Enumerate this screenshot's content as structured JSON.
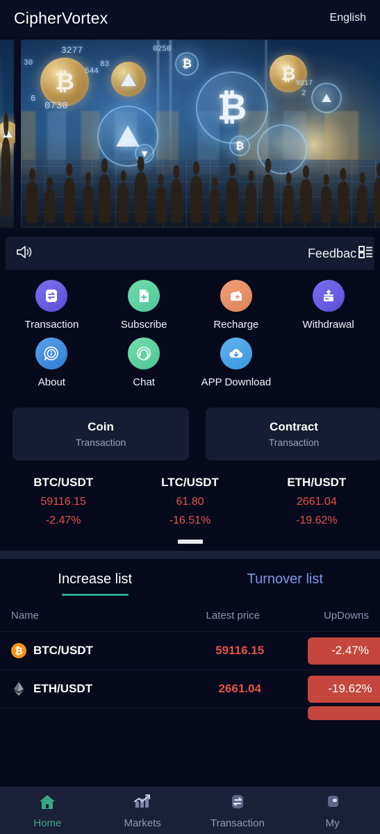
{
  "header": {
    "logo": "CipherVortex",
    "language": "English"
  },
  "banner": {
    "alt": "crypto-trading-banner",
    "slide_numbers": [
      "3277",
      "544",
      "0730",
      "30",
      "6",
      "0250",
      "83",
      "2",
      "9217"
    ]
  },
  "notice": {
    "speaker_icon": "speaker-icon",
    "feedback_label": "Feedbac",
    "grid_icon": "grid-list-icon"
  },
  "quick_menu": {
    "rows": [
      [
        {
          "label": "Transaction",
          "icon": "exchange-icon",
          "color": "#6c5ce7"
        },
        {
          "label": "Subscribe",
          "icon": "document-plus-icon",
          "color": "#63d4a5"
        },
        {
          "label": "Recharge",
          "icon": "wallet-in-icon",
          "color": "#e8936a"
        },
        {
          "label": "Withdrawal",
          "icon": "card-up-icon",
          "color": "#6c5ce7"
        }
      ],
      [
        {
          "label": "About",
          "icon": "info-bubble-icon",
          "color": "#3d8de0"
        },
        {
          "label": "Chat",
          "icon": "headset-icon",
          "color": "#63d4a5"
        },
        {
          "label": "APP Download",
          "icon": "cloud-download-icon",
          "color": "#49a5e8"
        }
      ]
    ]
  },
  "trade_cards": [
    {
      "title": "Coin",
      "subtitle": "Transaction"
    },
    {
      "title": "Contract",
      "subtitle": "Transaction"
    }
  ],
  "ticker": {
    "items": [
      {
        "pair": "BTC/USDT",
        "price": "59116.15",
        "change": "-2.47%"
      },
      {
        "pair": "LTC/USDT",
        "price": "61.80",
        "change": "-16.51%"
      },
      {
        "pair": "ETH/USDT",
        "price": "2661.04",
        "change": "-19.62%"
      }
    ],
    "down_color": "#e3524a"
  },
  "market_list": {
    "tabs": [
      {
        "label": "Increase list",
        "active": true
      },
      {
        "label": "Turnover list",
        "active": false
      }
    ],
    "columns": {
      "name": "Name",
      "price": "Latest price",
      "change": "UpDowns"
    },
    "rows": [
      {
        "pair": "BTC/USDT",
        "price": "59116.15",
        "change": "-2.47%",
        "icon": "bitcoin-icon",
        "symbol": "₿",
        "icon_color": "#f7931a"
      },
      {
        "pair": "ETH/USDT",
        "price": "2661.04",
        "change": "-19.62%",
        "icon": "ethereum-icon",
        "symbol": "",
        "icon_color": "#8b8f99"
      }
    ],
    "badge_color": "#c4463c",
    "accent_color": "#2fa68a"
  },
  "tabbar": [
    {
      "label": "Home",
      "icon": "home-icon",
      "active": true
    },
    {
      "label": "Markets",
      "icon": "chart-icon",
      "active": false
    },
    {
      "label": "Transaction",
      "icon": "exchange-icon",
      "active": false
    },
    {
      "label": "My",
      "icon": "profile-icon",
      "active": false
    }
  ]
}
